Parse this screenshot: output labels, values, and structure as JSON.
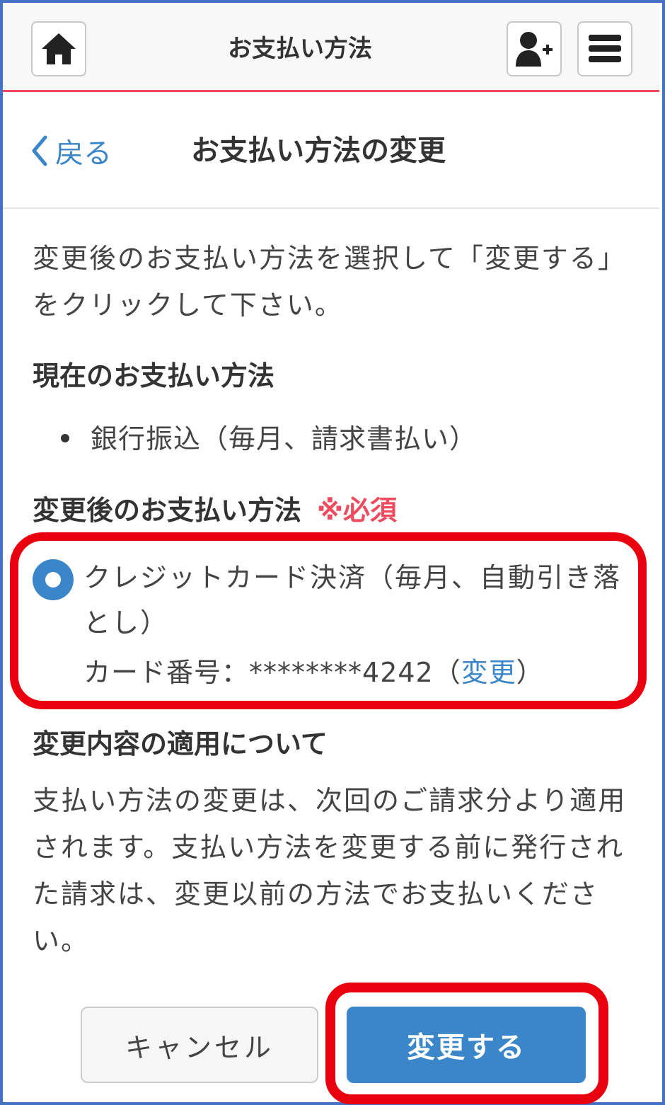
{
  "header": {
    "title": "お支払い方法",
    "icons": {
      "home": "home-icon",
      "add_user": "add-user-icon",
      "menu": "menu-icon"
    }
  },
  "subheader": {
    "back_label": "戻る",
    "title": "お支払い方法の変更"
  },
  "intro": "変更後のお支払い方法を選択して「変更する」をクリックして下さい。",
  "current": {
    "heading": "現在のお支払い方法",
    "item": "銀行振込（毎月、請求書払い）"
  },
  "new_method": {
    "heading": "変更後のお支払い方法",
    "required": "※必須",
    "option_label": "クレジットカード決済（毎月、自動引き落とし）",
    "card_prefix": "カード番号：",
    "card_number": "********4242",
    "paren_open": "（",
    "change_link": "変更",
    "paren_close": "）"
  },
  "apply": {
    "heading": "変更内容の適用について",
    "text": "支払い方法の変更は、次回のご請求分より適用されます。支払い方法を変更する前に発行された請求は、変更以前の方法でお支払いください。"
  },
  "buttons": {
    "cancel": "キャンセル",
    "submit": "変更する"
  },
  "colors": {
    "accent": "#3a86c8",
    "header_line": "#ee4b5f",
    "highlight": "#e8000e",
    "required": "#ee4b5f"
  }
}
